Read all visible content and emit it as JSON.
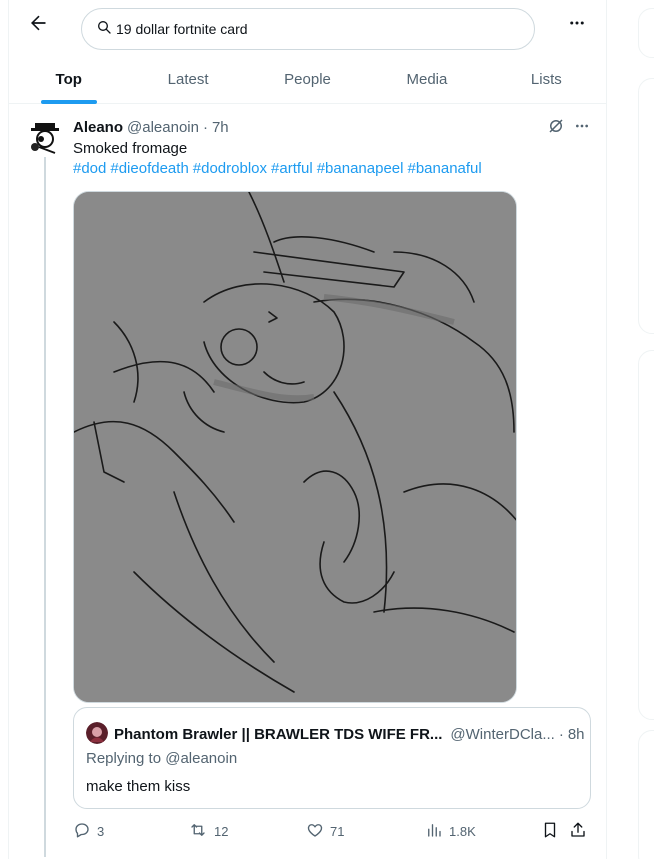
{
  "search": {
    "query": "19 dollar fortnite card"
  },
  "tabs": [
    {
      "label": "Top",
      "active": true
    },
    {
      "label": "Latest",
      "active": false
    },
    {
      "label": "People",
      "active": false
    },
    {
      "label": "Media",
      "active": false
    },
    {
      "label": "Lists",
      "active": false
    }
  ],
  "post": {
    "author_name": "Aleano",
    "author_handle": "@aleanoin",
    "time": "7h",
    "text": "Smoked fromage",
    "hashtags": [
      "#dod",
      "#dieofdeath",
      "#dodroblox",
      "#artful",
      "#bananapeel",
      "#bananaful"
    ],
    "quote": {
      "author_name": "Phantom Brawler || BRAWLER TDS WIFE FR...",
      "author_handle": "@WinterDCla...",
      "time": "8h",
      "replying_prefix": "Replying to",
      "replying_to": "@aleanoin",
      "text": "make them kiss"
    },
    "actions": {
      "replies": "3",
      "reposts": "12",
      "likes": "71",
      "views": "1.8K"
    }
  },
  "colors": {
    "accent": "#1d9bf0",
    "text_primary": "#0f1419",
    "text_secondary": "#536471",
    "border": "#cfd9de",
    "media_bg": "#8a8a8a"
  },
  "icons": {
    "back": "arrow-left-icon",
    "search": "search-icon",
    "more": "more-dots-icon",
    "grok": "grok-icon",
    "reply": "reply-icon",
    "repost": "repost-icon",
    "like": "heart-icon",
    "views": "views-chart-icon",
    "bookmark": "bookmark-icon",
    "share": "share-icon"
  }
}
